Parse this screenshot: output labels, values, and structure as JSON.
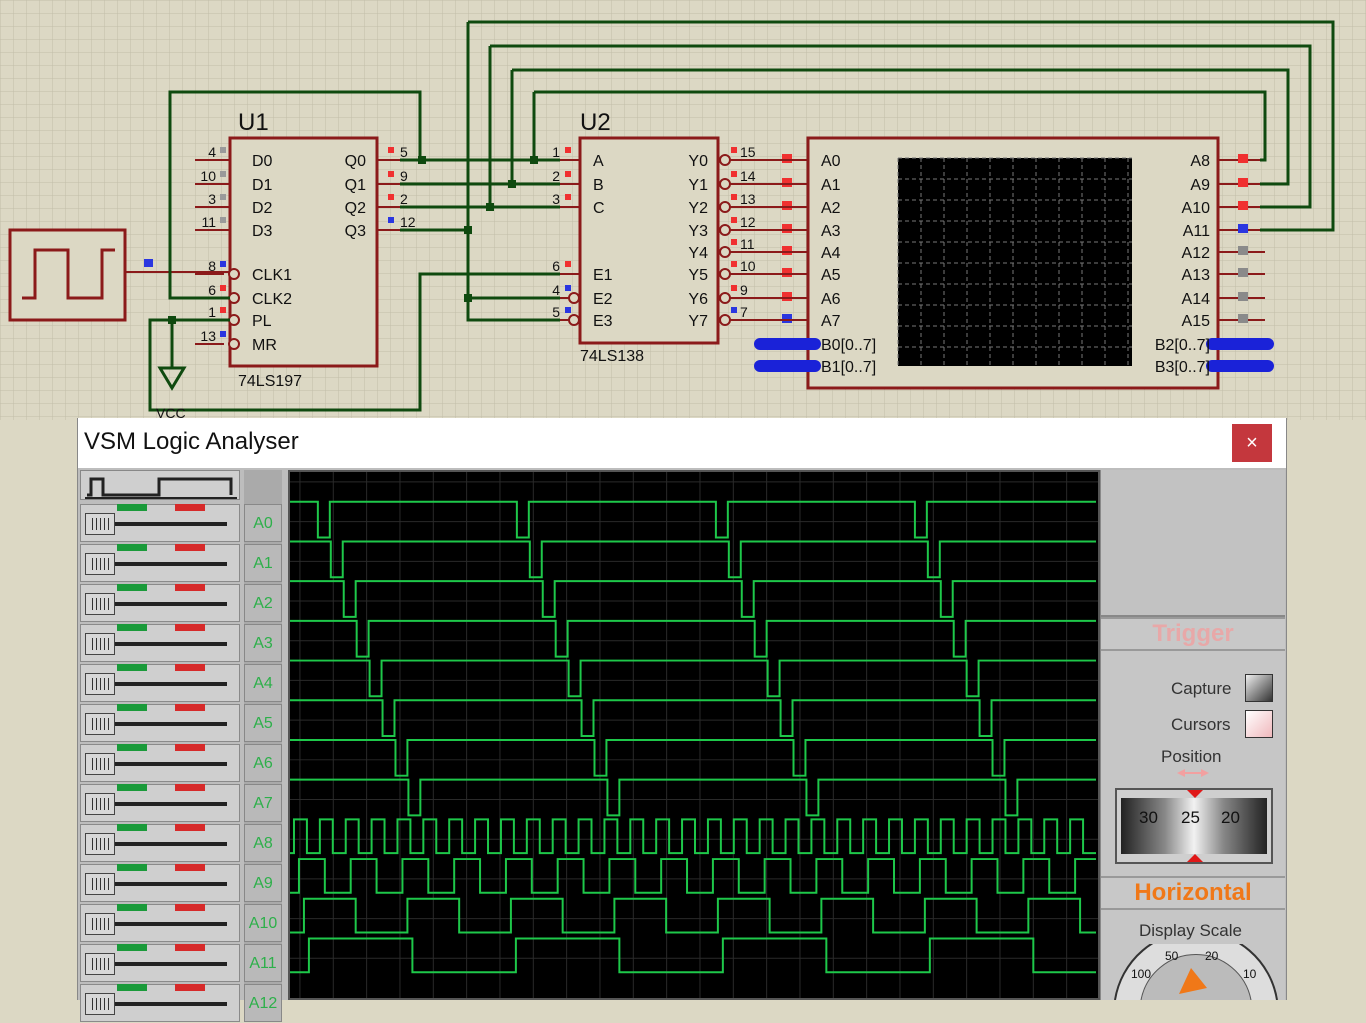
{
  "schematic": {
    "u1": {
      "ref": "U1",
      "part": "74LS197",
      "left_pins": [
        {
          "num": "4",
          "name": "D0"
        },
        {
          "num": "10",
          "name": "D1"
        },
        {
          "num": "3",
          "name": "D2"
        },
        {
          "num": "11",
          "name": "D3"
        },
        {
          "num": "8",
          "name": "CLK1"
        },
        {
          "num": "6",
          "name": "CLK2"
        },
        {
          "num": "1",
          "name": "PL"
        },
        {
          "num": "13",
          "name": "MR"
        }
      ],
      "right_pins": [
        {
          "num": "5",
          "name": "Q0"
        },
        {
          "num": "9",
          "name": "Q1"
        },
        {
          "num": "2",
          "name": "Q2"
        },
        {
          "num": "12",
          "name": "Q3"
        }
      ],
      "vcc_label": "VCC"
    },
    "u2": {
      "ref": "U2",
      "part": "74LS138",
      "left_pins": [
        {
          "num": "1",
          "name": "A"
        },
        {
          "num": "2",
          "name": "B"
        },
        {
          "num": "3",
          "name": "C"
        },
        {
          "num": "6",
          "name": "E1"
        },
        {
          "num": "4",
          "name": "E2"
        },
        {
          "num": "5",
          "name": "E3"
        }
      ],
      "right_pins": [
        {
          "num": "15",
          "name": "Y0"
        },
        {
          "num": "14",
          "name": "Y1"
        },
        {
          "num": "13",
          "name": "Y2"
        },
        {
          "num": "12",
          "name": "Y3"
        },
        {
          "num": "11",
          "name": "Y4"
        },
        {
          "num": "10",
          "name": "Y5"
        },
        {
          "num": "9",
          "name": "Y6"
        },
        {
          "num": "7",
          "name": "Y7"
        }
      ]
    },
    "analyzer": {
      "left_inputs": [
        "A0",
        "A1",
        "A2",
        "A3",
        "A4",
        "A5",
        "A6",
        "A7",
        "B0[0..7]",
        "B1[0..7]"
      ],
      "right_inputs": [
        "A8",
        "A9",
        "A10",
        "A11",
        "A12",
        "A13",
        "A14",
        "A15",
        "B2[0..7]",
        "B3[0..7]"
      ]
    }
  },
  "window": {
    "title": "VSM Logic Analyser",
    "close_label": "×"
  },
  "channels": [
    "A0",
    "A1",
    "A2",
    "A3",
    "A4",
    "A5",
    "A6",
    "A7",
    "A8",
    "A9",
    "A10",
    "A11",
    "A12"
  ],
  "panel": {
    "trigger_header": "Trigger",
    "capture_label": "Capture",
    "cursors_label": "Cursors",
    "position_label": "Position",
    "position_dial": [
      "30",
      "25",
      "20"
    ],
    "horizontal_header": "Horizontal",
    "display_scale_label": "Display Scale",
    "scale_dial": [
      "100",
      "50",
      "20",
      "10"
    ]
  },
  "colors": {
    "wire": "#0f4a0f",
    "component": "#8b1a1a",
    "trace": "#1ec84a",
    "trigger_header": "#e8a8a8",
    "horizontal_header": "#f07818"
  }
}
